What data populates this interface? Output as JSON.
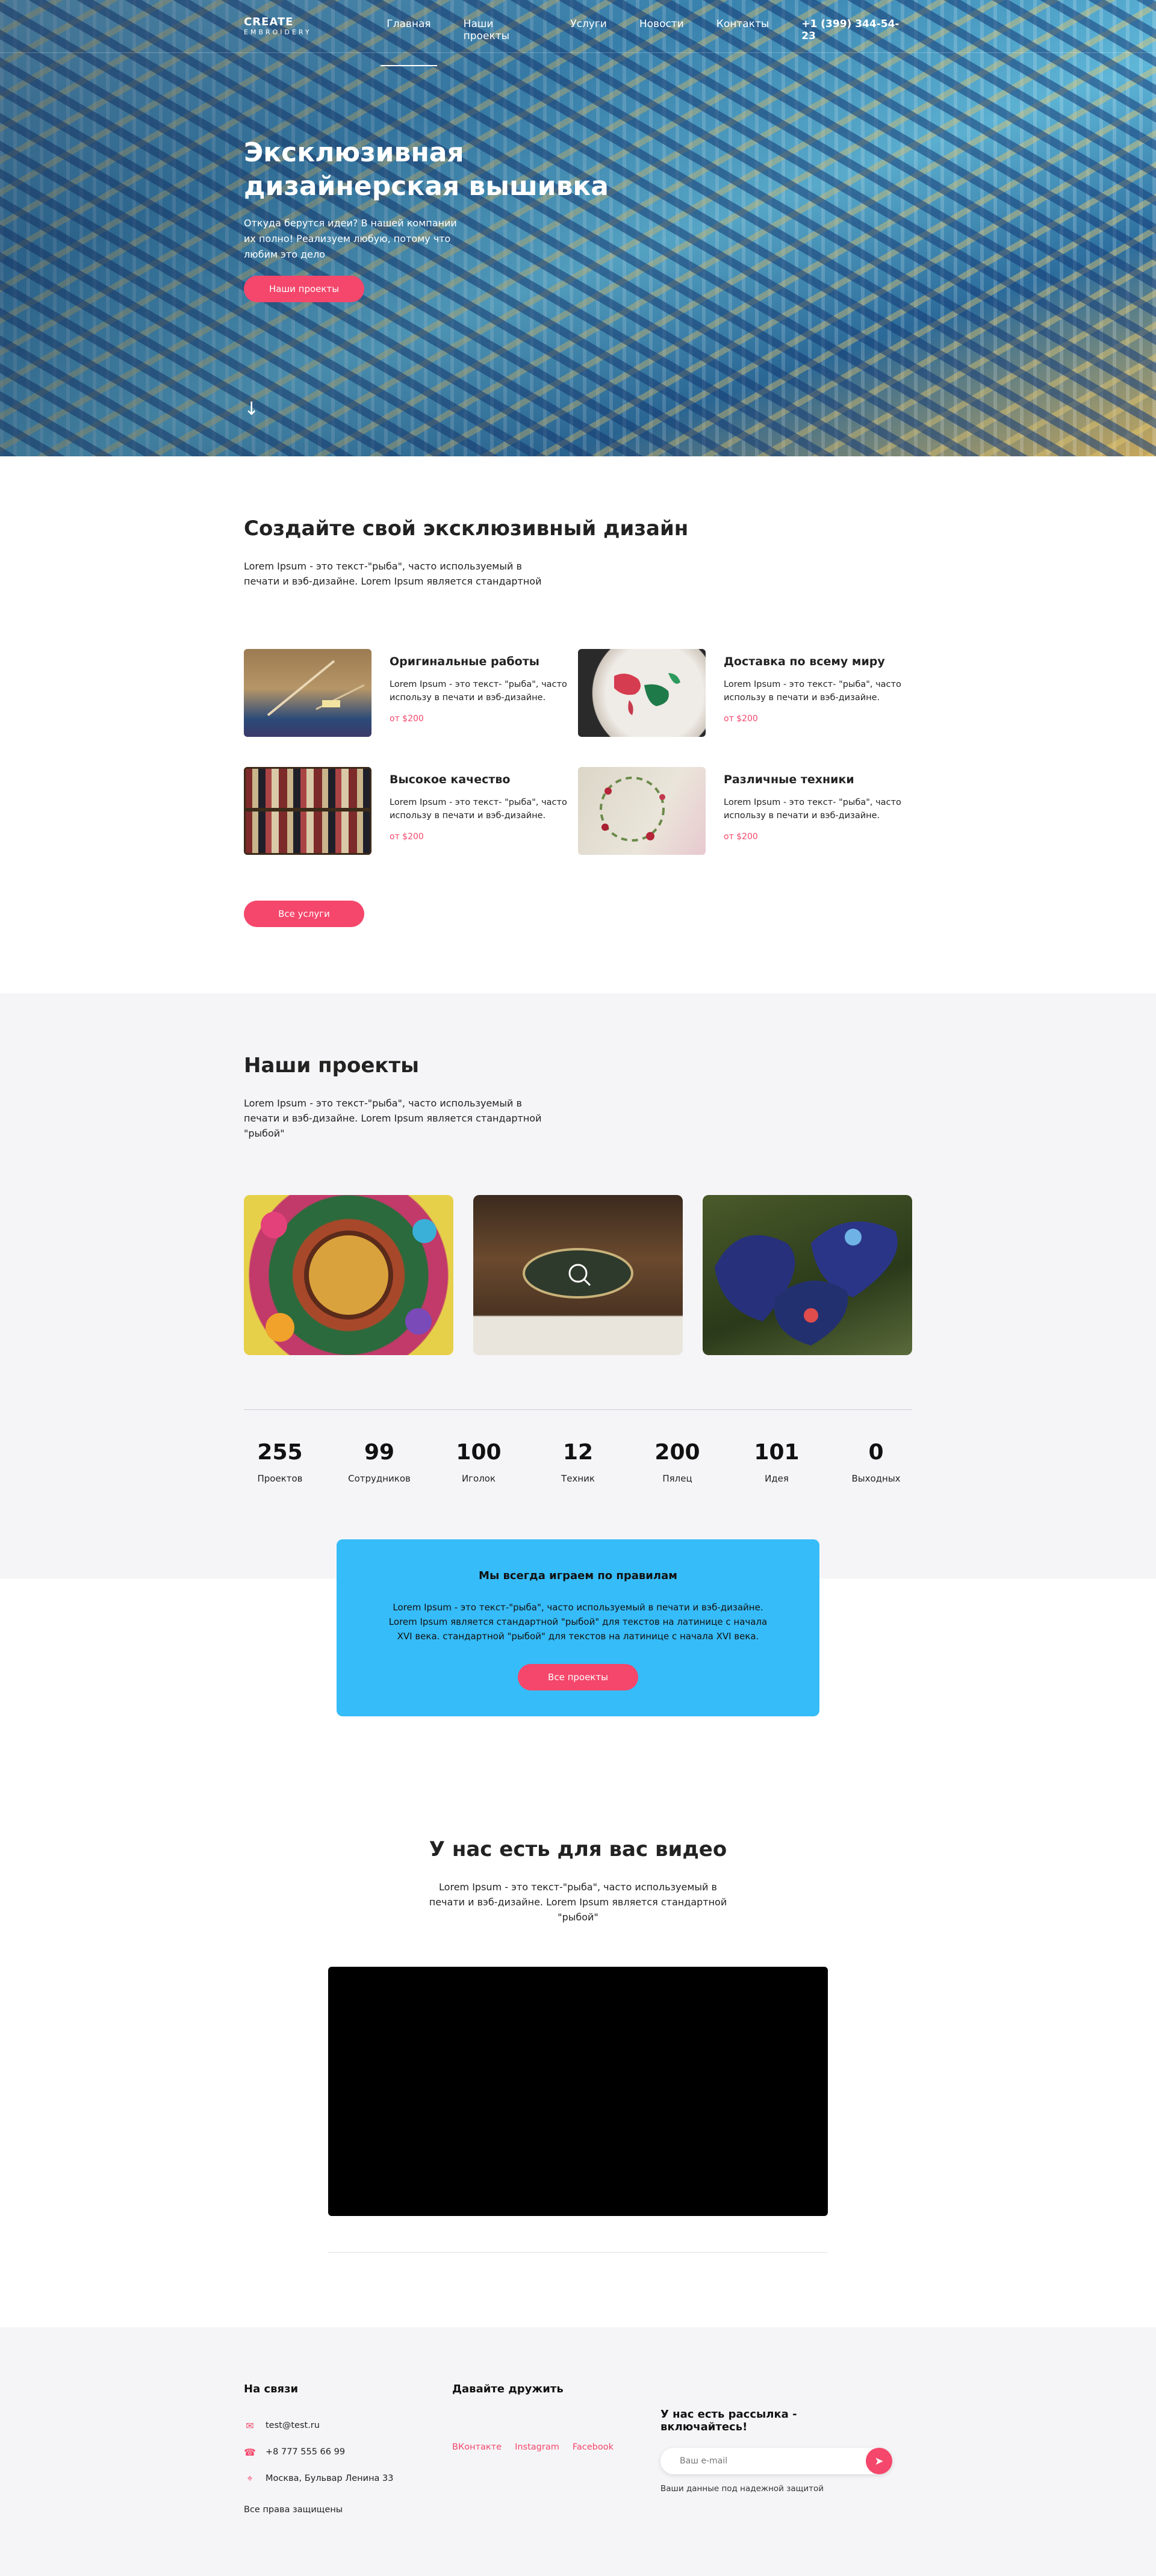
{
  "nav": {
    "logo_line1": "CREATE",
    "logo_line2": "EMBROIDERY",
    "items": [
      "Главная",
      "Наши проекты",
      "Услуги",
      "Новости",
      "Контакты"
    ],
    "phone": "+1 (399) 344-54-23"
  },
  "hero": {
    "title": "Эксклюзивная дизайнерская вышивка",
    "text": "Откуда берутся идеи? В нашей компании их полно! Реализуем любую, потому что любим это дело",
    "button": "Наши проекты"
  },
  "services": {
    "title": "Создайте свой эксклюзивный дизайн",
    "lead": "Lorem Ipsum - это текст-\"рыба\", часто используемый в печати и вэб-дизайне. Lorem Ipsum является стандартной",
    "items": [
      {
        "title": "Оригинальные работы",
        "text": "Lorem Ipsum - это текст- \"рыба\", часто использу в печати и вэб-дизайне.",
        "price": "от $200"
      },
      {
        "title": "Доставка по всему миру",
        "text": "Lorem Ipsum - это текст- \"рыба\", часто использу в печати и вэб-дизайне.",
        "price": "от $200"
      },
      {
        "title": "Высокое качество",
        "text": "Lorem Ipsum - это текст- \"рыба\", часто использу в печати и вэб-дизайне.",
        "price": "от $200"
      },
      {
        "title": "Различные техники",
        "text": "Lorem Ipsum - это текст- \"рыба\", часто использу в печати и вэб-дизайне.",
        "price": "от $200"
      }
    ],
    "button": "Все услуги"
  },
  "projects": {
    "title": "Наши проекты",
    "lead": "Lorem Ipsum - это текст-\"рыба\", часто используемый в печати и вэб-дизайне. Lorem Ipsum является стандартной \"рыбой\"",
    "stats": [
      {
        "num": "255",
        "label": "Проектов"
      },
      {
        "num": "99",
        "label": "Сотрудников"
      },
      {
        "num": "100",
        "label": "Иголок"
      },
      {
        "num": "12",
        "label": "Техник"
      },
      {
        "num": "200",
        "label": "Пялец"
      },
      {
        "num": "101",
        "label": "Идея"
      },
      {
        "num": "0",
        "label": "Выходных"
      }
    ]
  },
  "rules": {
    "title": "Мы всегда играем по правилам",
    "text": "Lorem Ipsum - это текст-\"рыба\", часто используемый в печати и вэб-дизайне. Lorem Ipsum является стандартной \"рыбой\" для текстов на латинице с начала XVI века. стандартной \"рыбой\" для текстов на латинице с начала XVI века.",
    "button": "Все проекты"
  },
  "video": {
    "title": "У нас есть для вас видео",
    "lead": "Lorem Ipsum - это текст-\"рыба\", часто используемый в печати и вэб-дизайне. Lorem Ipsum является стандартной \"рыбой\""
  },
  "footer": {
    "contacts_title": "На связи",
    "email": "test@test.ru",
    "phone": "+8 777 555 66 99",
    "address": "Москва, Бульвар Ленина 33",
    "rights": "Все права защищены",
    "friends_title": "Давайте дружить",
    "social": [
      "ВКонтакте",
      "Instagram",
      "Facebook"
    ],
    "subscribe_title": "У нас есть рассылка - включайтесь!",
    "email_placeholder": "Ваш e-mail",
    "note": "Ваши данные под надежной защитой"
  },
  "colors": {
    "accent": "#f4476b",
    "rules_bg": "#36bcf8",
    "section_bg": "#f5f5f7"
  }
}
